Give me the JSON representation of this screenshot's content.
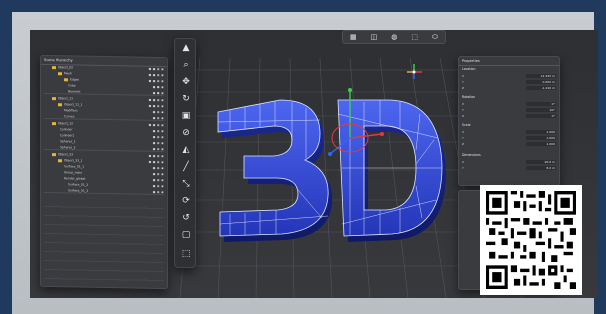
{
  "scene_tree": {
    "title": "Scene Hierarchy",
    "rows": [
      {
        "label": "Object_02",
        "flags": "● ● ◉ ◉"
      },
      {
        "label": "Mesh",
        "flags": "● ● ◉ ◉"
      },
      {
        "label": "Edges",
        "flags": "● ● ◉ ◉"
      },
      {
        "label": "Cube",
        "flags": "● ● ◉"
      },
      {
        "label": "Normals",
        "flags": "● ● ◉"
      },
      {
        "label": "Object_11",
        "flags": "● ● ◉ ◉"
      },
      {
        "label": "Object_11_1",
        "flags": "● ● ◉ ◉"
      },
      {
        "label": "Modifiers",
        "flags": "● ◉ ◉"
      },
      {
        "label": "Curves",
        "flags": "● ◉ ◉"
      },
      {
        "label": "Object_12",
        "flags": "● ● ◉ ◉"
      },
      {
        "label": "Cylinder",
        "flags": "● ◉ ◉"
      },
      {
        "label": "Cylinder1",
        "flags": "● ◉ ◉"
      },
      {
        "label": "Spheres_1",
        "flags": "● ◉ ◉"
      },
      {
        "label": "Spheres_2",
        "flags": "● ◉ ◉"
      },
      {
        "label": "Object_23",
        "flags": "● ● ◉ ◉"
      },
      {
        "label": "Object_23_1",
        "flags": "● ● ◉ ◉"
      },
      {
        "label": "Surface_01_1",
        "flags": "● ◉ ◉"
      },
      {
        "label": "Group_main",
        "flags": "● ◉ ◉"
      },
      {
        "label": "Render_global",
        "flags": "● ◉ ◉"
      },
      {
        "label": "Surface_01_2",
        "flags": "● ◉ ◉"
      },
      {
        "label": "Surface_01_3",
        "flags": "● ◉ ◉"
      }
    ]
  },
  "toolbar": {
    "tools": [
      "▲",
      "⌕",
      "✥",
      "↻",
      "▣",
      "⊘",
      "◭",
      "╱",
      "⤡",
      "⟳",
      "↺",
      "▢",
      "⬚"
    ]
  },
  "topbar": {
    "icons": [
      "▦",
      "◫",
      "◍",
      "⬚",
      "⬭"
    ]
  },
  "viewport": {
    "model_text": "3D",
    "accent": "#2f4bd6",
    "wire": "#ffffff"
  },
  "properties": {
    "title": "Properties",
    "sections": [
      {
        "name": "Location",
        "rows": [
          {
            "k": "X",
            "v": "12.345 m"
          },
          {
            "k": "Y",
            "v": "0.000 m"
          },
          {
            "k": "Z",
            "v": "-1.240 m"
          }
        ]
      },
      {
        "name": "Rotation",
        "rows": [
          {
            "k": "X",
            "v": "0°"
          },
          {
            "k": "Y",
            "v": "90°"
          },
          {
            "k": "Z",
            "v": "0°"
          }
        ]
      },
      {
        "name": "Scale",
        "rows": [
          {
            "k": "X",
            "v": "1.000"
          },
          {
            "k": "Y",
            "v": "1.000"
          },
          {
            "k": "Z",
            "v": "1.000"
          }
        ]
      },
      {
        "name": "Dimensions",
        "rows": [
          {
            "k": "X",
            "v": "20.6 m"
          },
          {
            "k": "Y",
            "v": "8.2 m"
          }
        ]
      }
    ]
  }
}
